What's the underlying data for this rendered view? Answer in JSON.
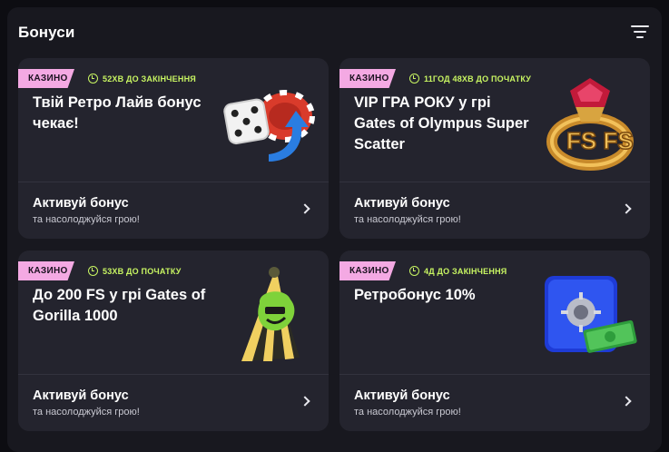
{
  "header": {
    "title": "Бонуси",
    "filter_icon": "filter-lines-icon"
  },
  "cards": [
    {
      "badge": "КАЗИНО",
      "timer": "52ХВ ДО ЗАКІНЧЕННЯ",
      "headline": "Твій Ретро Лайв бонус чекає!",
      "cta_title": "Активуй бонус",
      "cta_subtitle": "та насолоджуйся грою!",
      "art": "dice-chip-icon"
    },
    {
      "badge": "КАЗИНО",
      "timer": "11ГОД 48ХВ ДО ПОЧАТКУ",
      "headline": "VIP ГРА РОКУ у грі Gates of Olympus Super Scatter",
      "cta_title": "Активуй бонус",
      "cta_subtitle": "та насолоджуйся грою!",
      "art": "fs-ring-icon",
      "art_text": "FS FS"
    },
    {
      "badge": "КАЗИНО",
      "timer": "53ХВ ДО ПОЧАТКУ",
      "headline": "До 200 FS у грі Gates of Gorilla 1000",
      "cta_title": "Активуй бонус",
      "cta_subtitle": "та насолоджуйся грою!",
      "art": "party-hat-icon"
    },
    {
      "badge": "КАЗИНО",
      "timer": "4Д ДО ЗАКІНЧЕННЯ",
      "headline": "Ретробонус 10%",
      "cta_title": "Активуй бонус",
      "cta_subtitle": "та насолоджуйся грою!",
      "art": "safe-cash-icon"
    }
  ],
  "colors": {
    "badge": "#f4a9e3",
    "timer": "#c8f562",
    "card": "#24242e",
    "panel": "#18181f"
  }
}
